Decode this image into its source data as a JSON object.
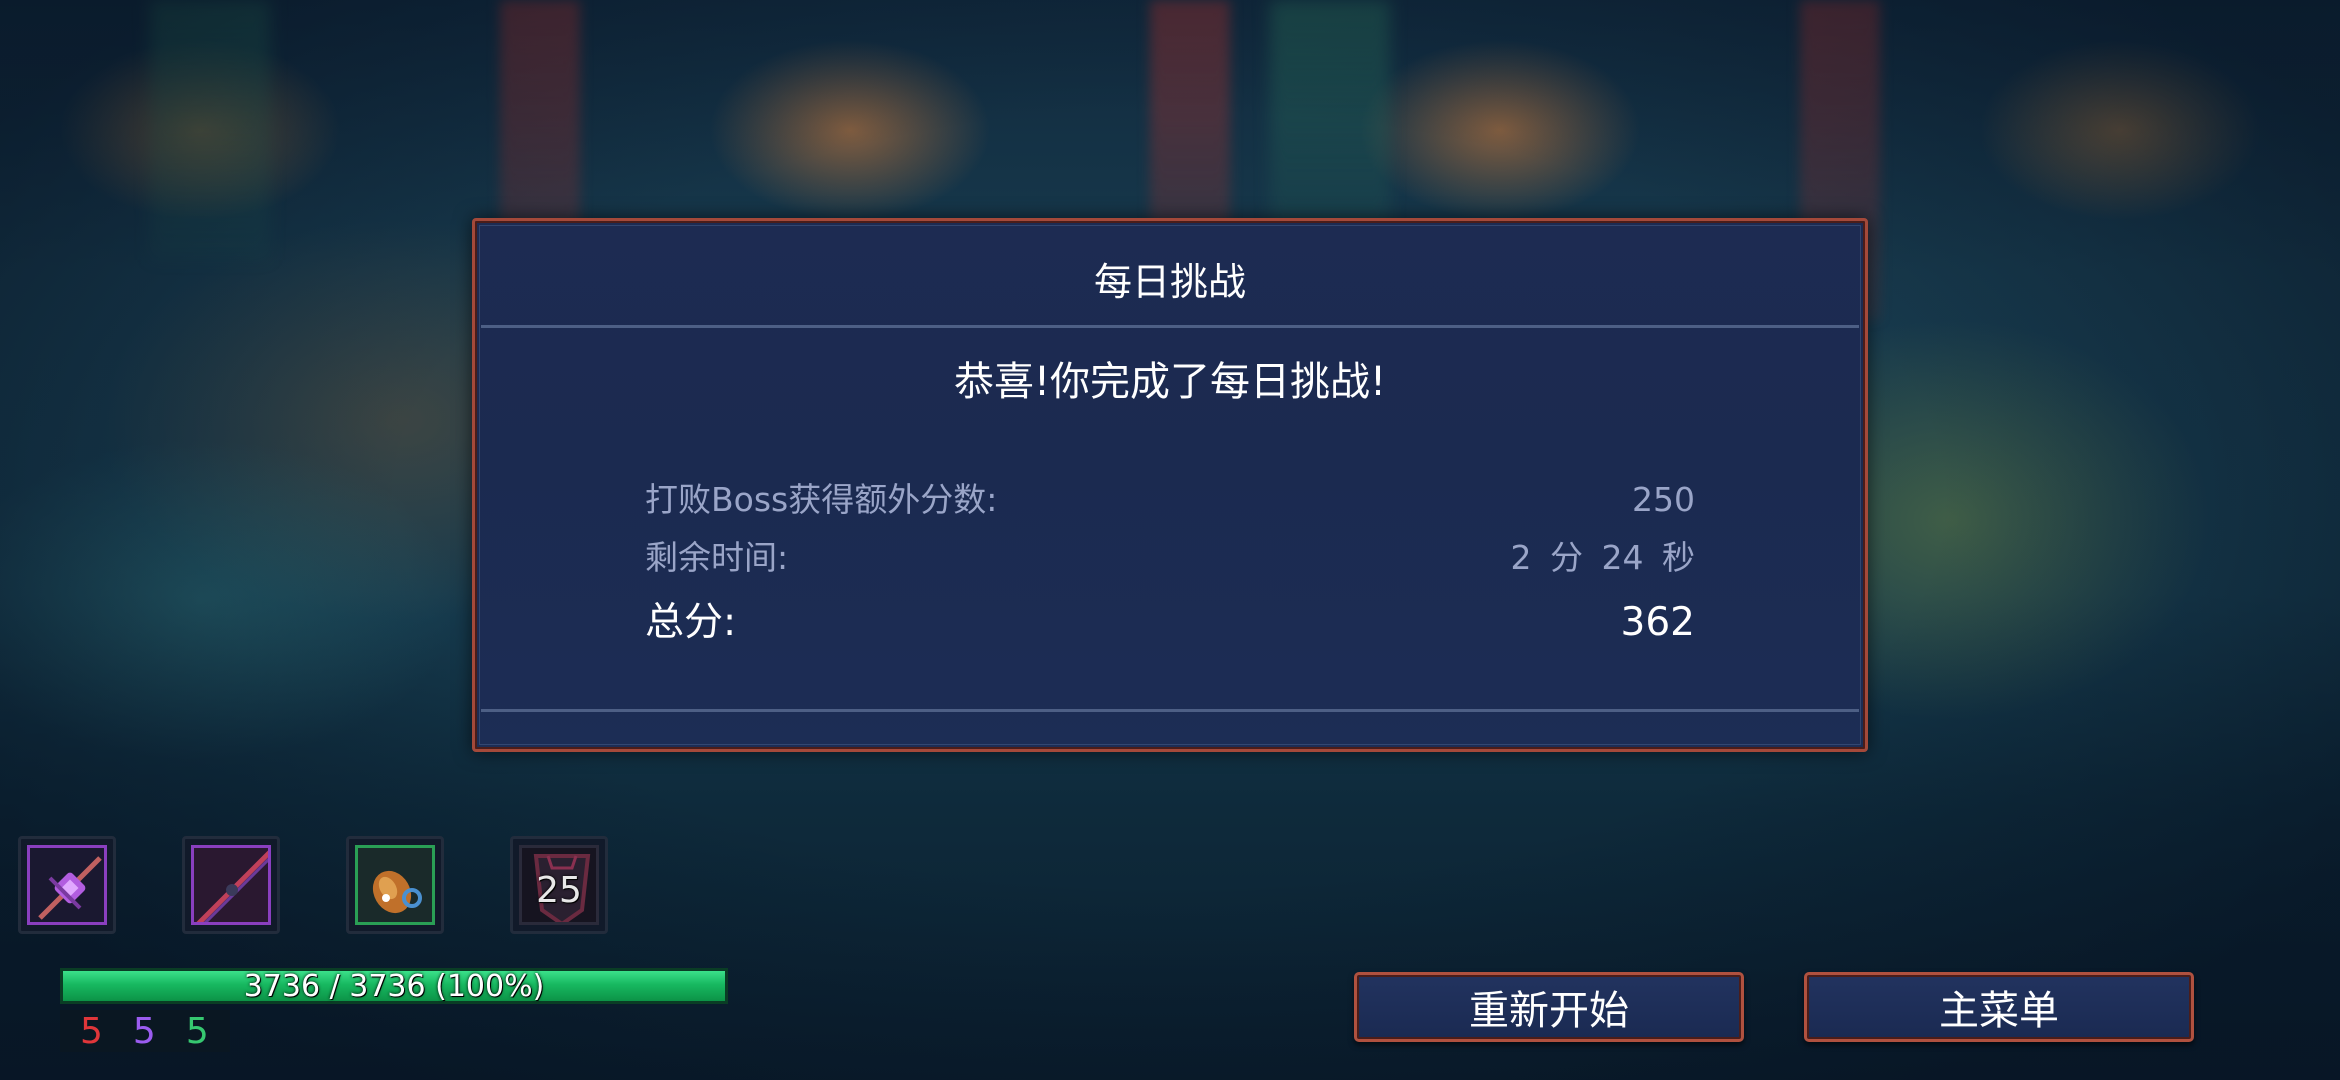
{
  "dialog": {
    "title": "每日挑战",
    "message": "恭喜!你完成了每日挑战!",
    "rows": [
      {
        "label": "打败Boss获得额外分数:",
        "value": "250"
      },
      {
        "label": "剩余时间:",
        "value": "2 分 24 秒"
      }
    ],
    "total": {
      "label": "总分:",
      "value": "362"
    }
  },
  "inventory": {
    "slots": [
      {
        "icon": "crossbow-weapon-icon",
        "border_color": "#8a3fbf"
      },
      {
        "icon": "dark-blade-weapon-icon",
        "border_color": "#8a3fbf"
      },
      {
        "icon": "grenade-skill-icon",
        "border_color": "#2a9e55"
      },
      {
        "icon": "amulet-icon",
        "border_color": "#2a2a3a",
        "count": "25"
      }
    ]
  },
  "health": {
    "text": "3736 / 3736 (100%)",
    "current": 3736,
    "max": 3736,
    "percent": 100,
    "color": "#17b860"
  },
  "stats": [
    {
      "value": "5",
      "color": "#e0363a",
      "name": "brutality"
    },
    {
      "value": "5",
      "color": "#9b5cf0",
      "name": "tactics"
    },
    {
      "value": "5",
      "color": "#36c870",
      "name": "survival"
    }
  ],
  "buttons": {
    "restart": "重新开始",
    "main_menu": "主菜单"
  }
}
